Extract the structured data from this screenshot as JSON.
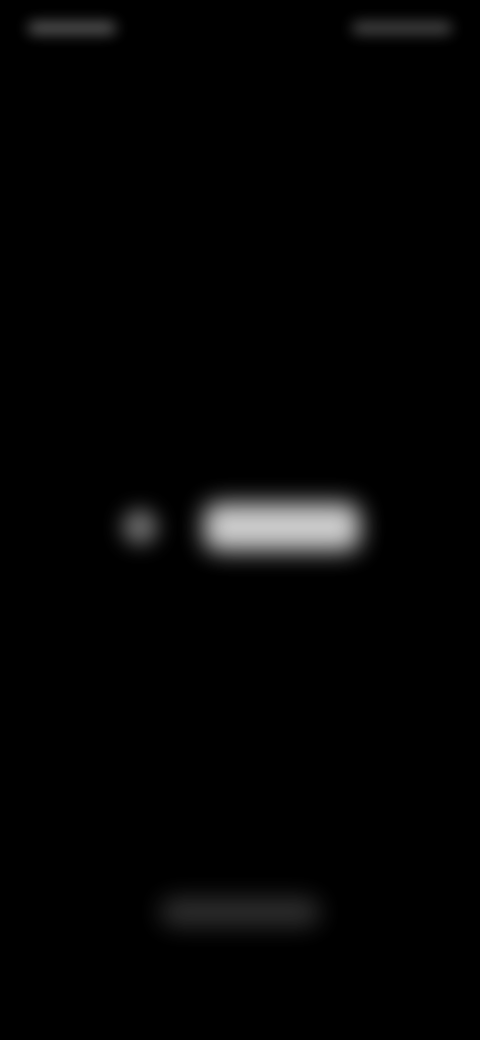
{
  "status_bar": {
    "left_text": "",
    "right_text": ""
  },
  "center": {
    "icon": "spinner-icon",
    "label": ""
  },
  "bottom": {
    "label": ""
  },
  "colors": {
    "background": "#000000"
  }
}
